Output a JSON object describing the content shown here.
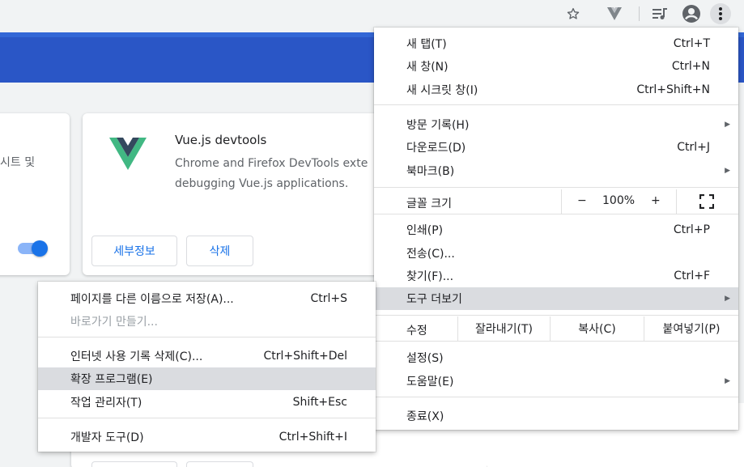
{
  "toolbar": {
    "icons": [
      "star-icon",
      "vue-devtools-icon",
      "playlist-icon",
      "account-icon",
      "more-vert-icon"
    ]
  },
  "left_card": {
    "desc": "시트 및"
  },
  "extension_card": {
    "title": "Vue.js devtools",
    "desc_line1": "Chrome and Firefox DevTools exte",
    "desc_line2": "debugging Vue.js applications.",
    "details_button": "세부정보",
    "remove_button": "삭제",
    "logo_colors": {
      "outer": "#41b883",
      "inner": "#34495e"
    }
  },
  "main_menu": {
    "new_tab": {
      "label": "새 탭(T)",
      "shortcut": "Ctrl+T"
    },
    "new_window": {
      "label": "새 창(N)",
      "shortcut": "Ctrl+N"
    },
    "new_incognito": {
      "label": "새 시크릿 창(I)",
      "shortcut": "Ctrl+Shift+N"
    },
    "history": {
      "label": "방문 기록(H)"
    },
    "downloads": {
      "label": "다운로드(D)",
      "shortcut": "Ctrl+J"
    },
    "bookmarks": {
      "label": "북마크(B)"
    },
    "zoom": {
      "label": "글꼴 크기",
      "minus": "−",
      "value": "100%",
      "plus": "+"
    },
    "print": {
      "label": "인쇄(P)",
      "shortcut": "Ctrl+P"
    },
    "cast": {
      "label": "전송(C)..."
    },
    "find": {
      "label": "찾기(F)...",
      "shortcut": "Ctrl+F"
    },
    "more_tools": {
      "label": "도구 더보기"
    },
    "edit": {
      "label": "수정",
      "cut": "잘라내기(T)",
      "copy": "복사(C)",
      "paste": "붙여넣기(P)"
    },
    "settings": {
      "label": "설정(S)"
    },
    "help": {
      "label": "도움말(E)"
    },
    "exit": {
      "label": "종료(X)"
    }
  },
  "sub_menu": {
    "save_page": {
      "label": "페이지를 다른 이름으로 저장(A)...",
      "shortcut": "Ctrl+S"
    },
    "create_shortcut": {
      "label": "바로가기 만들기..."
    },
    "clear_data": {
      "label": "인터넷 사용 기록 삭제(C)...",
      "shortcut": "Ctrl+Shift+Del"
    },
    "extensions": {
      "label": "확장 프로그램(E)"
    },
    "task_manager": {
      "label": "작업 관리자(T)",
      "shortcut": "Shift+Esc"
    },
    "dev_tools": {
      "label": "개발자 도구(D)",
      "shortcut": "Ctrl+Shift+I"
    }
  },
  "colors": {
    "header_blue": "#3367d6",
    "accent": "#1a73e8",
    "menu_highlight": "#dadce0"
  }
}
